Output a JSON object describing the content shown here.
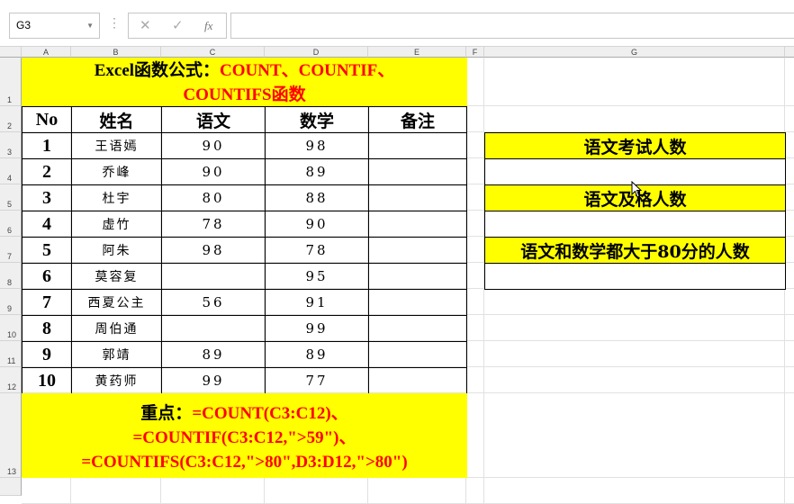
{
  "formula_bar": {
    "name_box": "G3",
    "cancel": "✕",
    "enter": "✓",
    "fx": "fx",
    "formula": ""
  },
  "columns": [
    "A",
    "B",
    "C",
    "D",
    "E",
    "F",
    "G"
  ],
  "rows": [
    "1",
    "2",
    "3",
    "4",
    "5",
    "6",
    "7",
    "8",
    "9",
    "10",
    "11",
    "12",
    "13"
  ],
  "title": {
    "black": "Excel函数公式：",
    "red1": "COUNT、COUNTIF、",
    "red2": "COUNTIFS函数"
  },
  "headers": [
    "No",
    "姓名",
    "语文",
    "数学",
    "备注"
  ],
  "table": [
    [
      "1",
      "王语嫣",
      "90",
      "98",
      ""
    ],
    [
      "2",
      "乔峰",
      "90",
      "89",
      ""
    ],
    [
      "3",
      "杜宇",
      "80",
      "88",
      ""
    ],
    [
      "4",
      "虚竹",
      "78",
      "90",
      ""
    ],
    [
      "5",
      "阿朱",
      "98",
      "78",
      ""
    ],
    [
      "6",
      "莫容复",
      "",
      "95",
      ""
    ],
    [
      "7",
      "西夏公主",
      "56",
      "91",
      ""
    ],
    [
      "8",
      "周伯通",
      "",
      "99",
      ""
    ],
    [
      "9",
      "郭靖",
      "89",
      "89",
      ""
    ],
    [
      "10",
      "黄药师",
      "99",
      "77",
      ""
    ]
  ],
  "note": {
    "label": "重点：",
    "line1": "=COUNT(C3:C12)、",
    "line2": "=COUNTIF(C3:C12,\">59\")、",
    "line3": "=COUNTIFS(C3:C12,\">80\",D3:D12,\">80\")"
  },
  "side": [
    "语文考试人数",
    "",
    "语文及格人数",
    "",
    "语文和数学都大于80分的人数",
    ""
  ]
}
